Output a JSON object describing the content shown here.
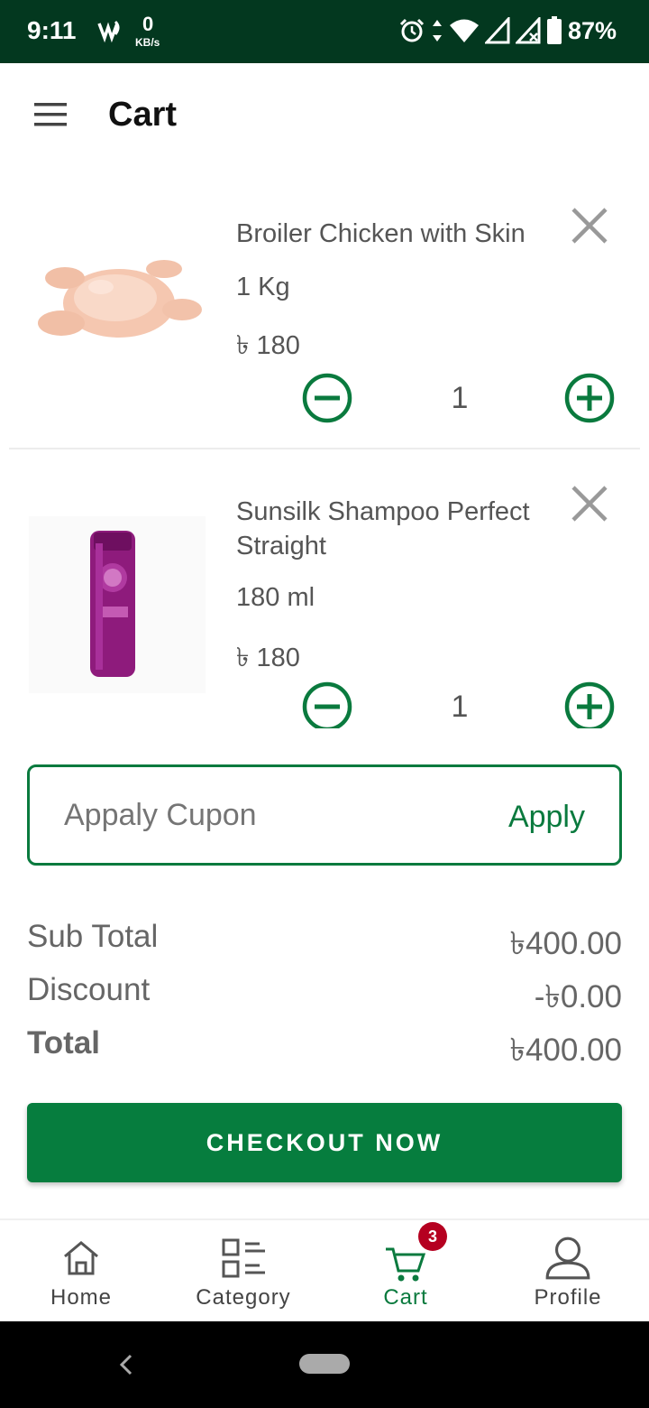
{
  "status_bar": {
    "time": "9:11",
    "net_speed_value": "0",
    "net_speed_unit": "KB/s",
    "battery": "87%",
    "icons": [
      "wifi-calling-icon",
      "alarm-icon",
      "data-arrows-icon",
      "wifi-icon",
      "signal-icon",
      "signal-x-icon",
      "battery-icon"
    ]
  },
  "header": {
    "title": "Cart",
    "menu_icon": "hamburger-menu-icon"
  },
  "cart_items": [
    {
      "name": "Broiler Chicken with Skin",
      "size": "1 Kg",
      "price": "৳ 180",
      "quantity": "1",
      "image": "chicken-image"
    },
    {
      "name": "Sunsilk Shampoo Perfect Straight",
      "size": "180 ml",
      "price": "৳ 180",
      "quantity": "1",
      "image": "shampoo-bottle-image"
    }
  ],
  "coupon": {
    "placeholder": "Appaly Cupon",
    "apply_label": "Apply"
  },
  "summary": {
    "subtotal_label": "Sub Total",
    "subtotal_value": "৳400.00",
    "discount_label": "Discount",
    "discount_value": "-৳0.00",
    "total_label": "Total",
    "total_value": "৳400.00"
  },
  "checkout": {
    "label": "CHECKOUT NOW"
  },
  "bottom_nav": {
    "items": [
      {
        "label": "Home",
        "icon": "home-icon"
      },
      {
        "label": "Category",
        "icon": "category-icon"
      },
      {
        "label": "Cart",
        "icon": "cart-icon",
        "badge": "3",
        "active": true
      },
      {
        "label": "Profile",
        "icon": "profile-icon"
      }
    ]
  },
  "colors": {
    "status_bar": "#03381f",
    "accent_green": "#0a7a3e",
    "button_green": "#067d3e",
    "badge_red": "#b50020"
  }
}
